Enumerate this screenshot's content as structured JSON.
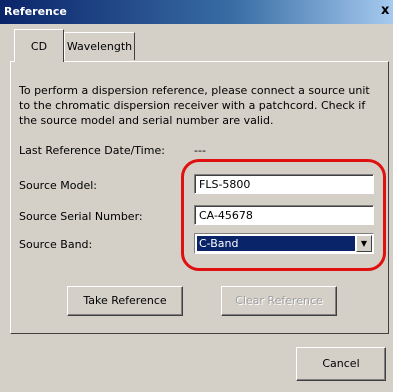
{
  "window": {
    "title": "Reference",
    "close_glyph": "x"
  },
  "tabs": [
    {
      "label": "CD",
      "active": true
    },
    {
      "label": "Wavelength",
      "active": false
    }
  ],
  "content": {
    "intro": "To perform a dispersion reference, please connect a source unit to the chromatic dispersion receiver with a patchcord. Check if the source model and serial number are valid.",
    "last_ref_label": "Last Reference Date/Time:",
    "last_ref_value": "---",
    "source_model_label": "Source Model:",
    "source_model_value": "FLS-5800",
    "source_serial_label": "Source Serial Number:",
    "source_serial_value": "CA-45678",
    "source_band_label": "Source Band:",
    "source_band_value": "C-Band"
  },
  "buttons": {
    "take_reference": "Take Reference",
    "clear_reference": "Clear Reference",
    "cancel": "Cancel"
  },
  "colors": {
    "title_gradient_start": "#0a246a",
    "dialog_face": "#d4d0c8",
    "highlight_ring": "#e01010",
    "selection": "#0a246a"
  }
}
